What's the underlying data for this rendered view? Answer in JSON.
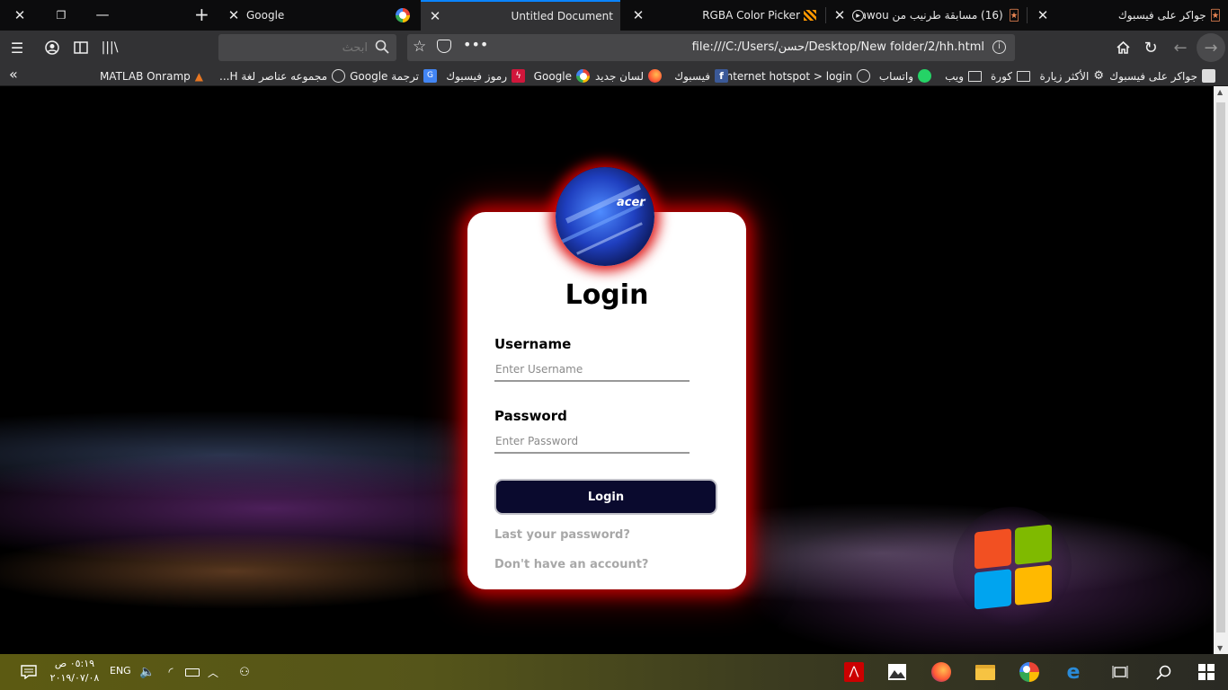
{
  "tabs": [
    {
      "title": "جواكر على فيسبوك",
      "icon": "joker-icon"
    },
    {
      "title": "(16) مسابقة طرنيب من awou",
      "icon": "joker-icon"
    },
    {
      "title": "RGBA Color Picker",
      "icon": "color-picker-icon"
    },
    {
      "title": "Untitled Document",
      "icon": "document-icon",
      "active": true
    },
    {
      "title": "Google",
      "icon": "google-icon"
    }
  ],
  "navbar": {
    "url": "file:///C:/Users/حسن/Desktop/New folder/2/hh.html",
    "search_placeholder": "ابحث"
  },
  "bookmarks": [
    {
      "label": "جواكر على فيسبوك"
    },
    {
      "label": "الأكثر زيارة"
    },
    {
      "label": "كورة"
    },
    {
      "label": "ويب"
    },
    {
      "label": "واتساب"
    },
    {
      "label": "internet hotspot > login"
    },
    {
      "label": "فيسبوك"
    },
    {
      "label": "لسان جديد"
    },
    {
      "label": "Google"
    },
    {
      "label": "رموز فيسبوك"
    },
    {
      "label": "ترجمة Google"
    },
    {
      "label": "مجموعه عناصر لغة H..."
    },
    {
      "label": "MATLAB Onramp"
    }
  ],
  "login": {
    "title": "Login",
    "avatar_logo": "acer",
    "username_label": "Username",
    "username_placeholder": "Enter Username",
    "password_label": "Password",
    "password_placeholder": "Enter Password",
    "button_label": "Login",
    "forgot_link": "Last your password?",
    "signup_link": "Don't have an account?"
  },
  "taskbar": {
    "time": "٠٥:١٩ ص",
    "date": "٢٠١٩/٠٧/٠٨",
    "language": "ENG"
  },
  "colors": {
    "accent": "#0a84ff",
    "card_glow": "#d00000",
    "button_bg": "#0a0a2e"
  }
}
